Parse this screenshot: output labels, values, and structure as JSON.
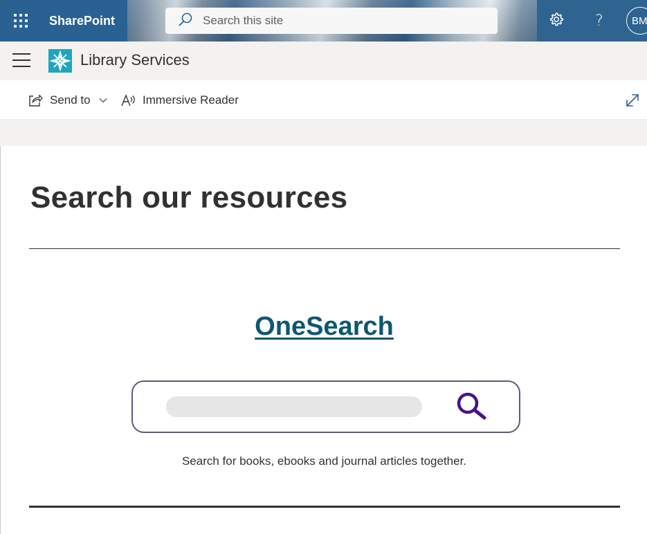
{
  "suite_bar": {
    "brand": "SharePoint",
    "search_placeholder": "Search this site",
    "avatar_initials": "BM",
    "help_label": "?"
  },
  "site_header": {
    "title": "Library Services"
  },
  "command_bar": {
    "send_to_label": "Send to",
    "immersive_reader_label": "Immersive Reader"
  },
  "main": {
    "page_title": "Search our resources",
    "onesearch_link": "OneSearch",
    "onesearch_caption": "Search for books, ebooks and journal articles together."
  },
  "colors": {
    "suite_blue": "#2a6193",
    "link_teal": "#0e5770",
    "search_icon_purple": "#4b0f8a",
    "site_logo": "#1fa5bf"
  },
  "icons": [
    "waffle-icon",
    "search-icon",
    "gear-icon",
    "help-icon",
    "hamburger-icon",
    "site-logo",
    "share-icon",
    "chevron-down-icon",
    "immersive-reader-icon",
    "expand-icon",
    "magnifier-icon"
  ]
}
